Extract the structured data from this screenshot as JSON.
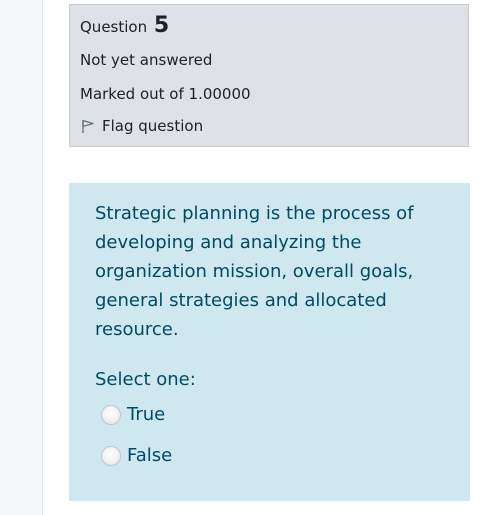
{
  "question_info": {
    "label": "Question",
    "number": "5",
    "state": "Not yet answered",
    "grade": "Marked out of 1.00000",
    "flag_label": "Flag question",
    "flag_icon": "flag-icon"
  },
  "question": {
    "text": "Strategic planning is the process of developing and analyzing the organization mission, overall goals, general strategies and allocated resource.",
    "prompt": "Select one:",
    "options": [
      {
        "label": "True",
        "selected": false
      },
      {
        "label": "False",
        "selected": false
      }
    ]
  },
  "colors": {
    "info_bg": "#dee2e6",
    "content_bg": "#cfe7ee",
    "content_text": "#004a63"
  }
}
